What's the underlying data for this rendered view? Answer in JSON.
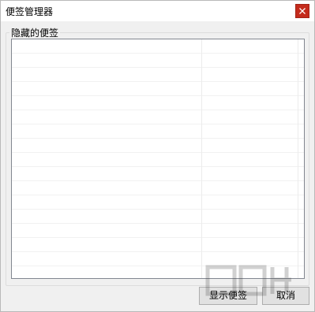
{
  "window": {
    "title": "便签管理器",
    "close_icon": "close-icon"
  },
  "group": {
    "label": "隐藏的便签"
  },
  "list": {
    "rows": [
      "",
      "",
      "",
      "",
      "",
      "",
      "",
      "",
      "",
      "",
      "",
      "",
      "",
      "",
      "",
      "",
      ""
    ]
  },
  "buttons": {
    "show_label": "显示便签",
    "cancel_label": "取消"
  },
  "colors": {
    "close_bg": "#c42b1c",
    "window_bg": "#f0f0f0"
  }
}
